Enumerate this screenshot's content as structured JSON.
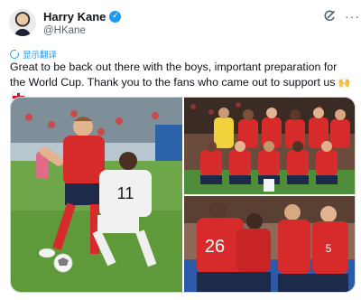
{
  "author": {
    "name": "Harry Kane",
    "handle": "@HKane",
    "verified": true,
    "avatar_icon": "profile-photo"
  },
  "header_icons": [
    "grok-icon",
    "more-icon"
  ],
  "translate": {
    "label": "显示翻译",
    "icon": "translate-icon"
  },
  "tweet": {
    "text": "Great to be back out there with the boys, important preparation for the World Cup. Thank you to the fans who came out to support us",
    "emoji": [
      "raised-hands",
      "england-flag"
    ]
  },
  "media": {
    "photos": [
      {
        "label": "match-action-photo",
        "jersey_number": "11"
      },
      {
        "label": "team-photo"
      },
      {
        "label": "players-huddle-photo",
        "jersey_number": "26"
      }
    ],
    "colors": {
      "england_red": "#d72a2b",
      "pitch_green": "#5f9a3a",
      "away_white": "#f1f1f1"
    }
  }
}
